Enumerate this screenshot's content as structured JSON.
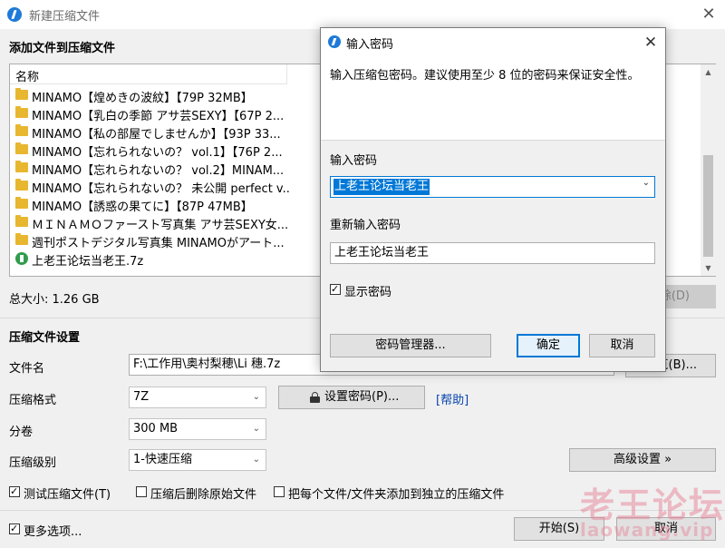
{
  "window": {
    "title": "新建压缩文件",
    "close_glyph": "✕"
  },
  "add_section": {
    "title": "添加文件到压缩文件"
  },
  "file_list": {
    "column_name": "名称",
    "items": [
      {
        "name": "MINAMO【煌めきの波紋】【79P 32MB】",
        "type": "folder"
      },
      {
        "name": "MINAMO【乳白の季節 アサ芸SEXY】【67P 2...",
        "type": "folder"
      },
      {
        "name": "MINAMO【私の部屋でしませんか】【93P 33...",
        "type": "folder"
      },
      {
        "name": "MINAMO【忘れられないの？ vol.1】【76P 2...",
        "type": "folder"
      },
      {
        "name": "MINAMO【忘れられないの？ vol.2】MINAM...",
        "type": "folder"
      },
      {
        "name": "MINAMO【忘れられないの？ 未公開 perfect v...",
        "type": "folder"
      },
      {
        "name": "MINAMO【誘惑の果てに】【87P 47MB】",
        "type": "folder"
      },
      {
        "name": "ＭＩＮＡＭＯファースト写真集 アサ芸SEXY女...",
        "type": "folder"
      },
      {
        "name": "週刊ポストデジタル写真集 MINAMOがアート...",
        "type": "folder"
      },
      {
        "name": "上老王论坛当老王.7z",
        "type": "archive"
      }
    ]
  },
  "total_size": "总大小: 1.26 GB",
  "delete_button": "除(D)",
  "settings": {
    "title": "压缩文件设置",
    "filename_label": "文件名",
    "filename_value": "F:\\工作用\\奥村梨穂\\Li 穗.7z",
    "browse_button": "览(B)...",
    "format_label": "压缩格式",
    "format_value": "7Z",
    "set_password_button": "设置密码(P)...",
    "help_link": "[帮助]",
    "split_label": "分卷",
    "split_value": "300 MB",
    "level_label": "压缩级别",
    "level_value": "1-快速压缩",
    "advanced_button": "高级设置 »",
    "test_checkbox": "测试压缩文件(T)",
    "delete_source_checkbox": "压缩后删除原始文件",
    "each_separate_checkbox": "把每个文件/文件夹添加到独立的压缩文件"
  },
  "footer": {
    "more_options": "更多选项...",
    "start_button": "开始(S)",
    "cancel_button": "取消"
  },
  "watermark": {
    "cn": "老王论坛",
    "en": "laowang.vip"
  },
  "dialog": {
    "title": "输入密码",
    "close_glyph": "✕",
    "description": "输入压缩包密码。建议使用至少 8 位的密码来保证安全性。",
    "password_label": "输入密码",
    "password_value": "上老王论坛当老王",
    "repeat_label": "重新输入密码",
    "repeat_value": "上老王论坛当老王",
    "show_password": "显示密码",
    "manager_button": "密码管理器...",
    "ok_button": "确定",
    "cancel_button": "取消"
  }
}
